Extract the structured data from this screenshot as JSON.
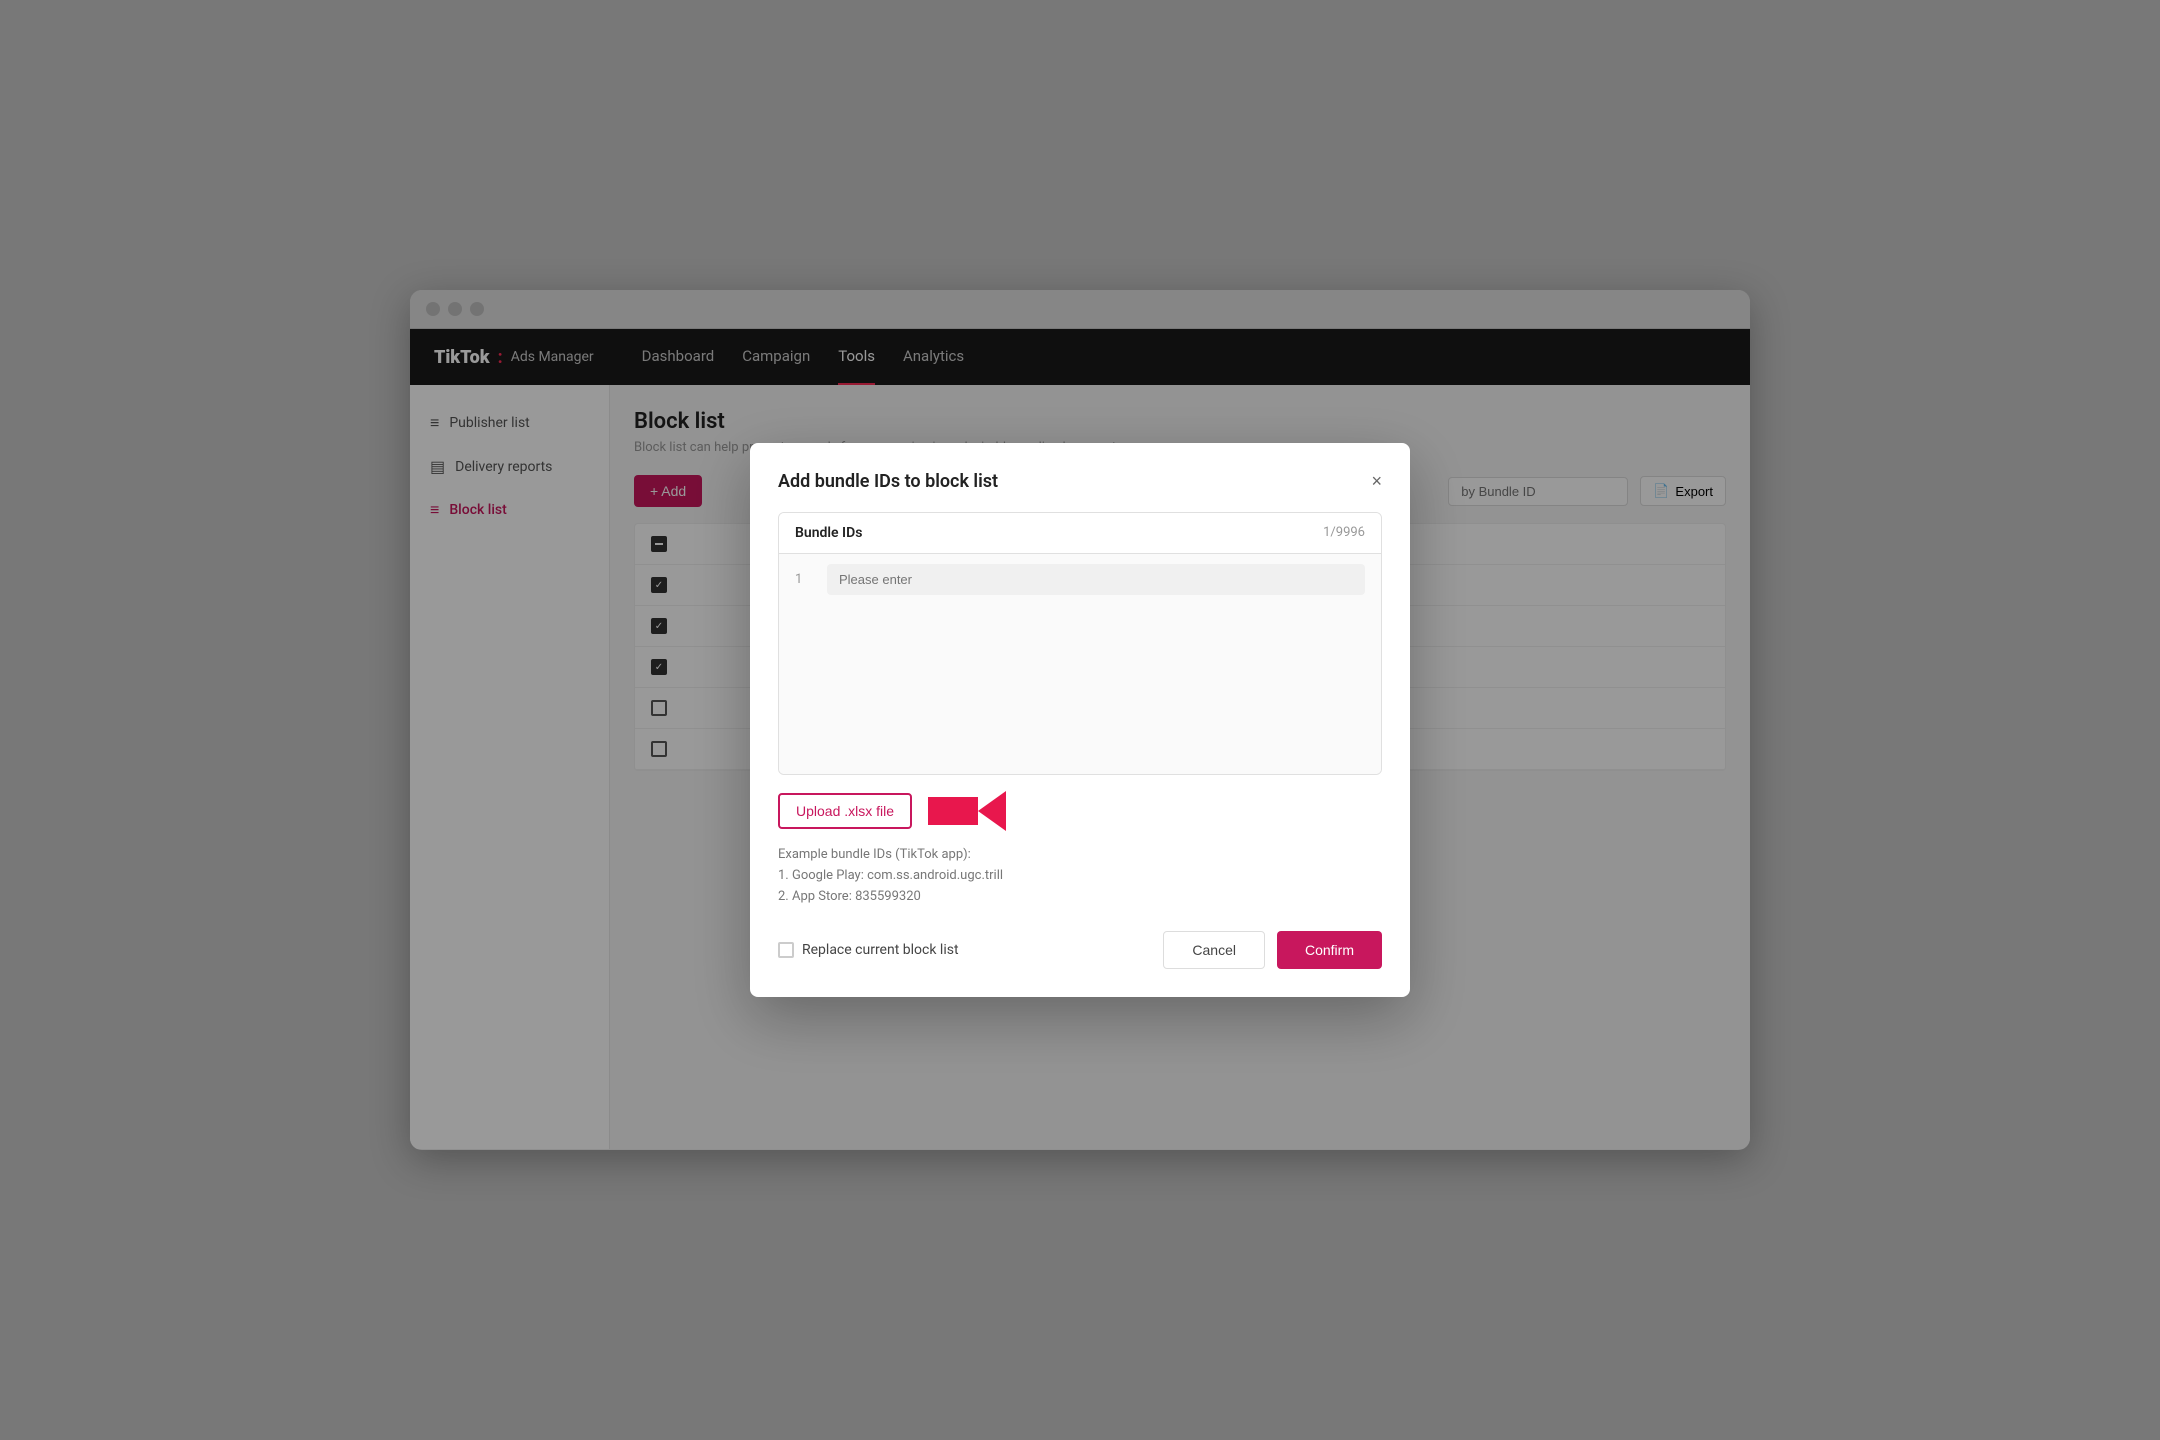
{
  "browser": {
    "dots": [
      "dot1",
      "dot2",
      "dot3"
    ]
  },
  "nav": {
    "brand": "TikTok",
    "brand_colon": ":",
    "brand_sub": "Ads Manager",
    "items": [
      {
        "label": "Dashboard",
        "active": false
      },
      {
        "label": "Campaign",
        "active": false
      },
      {
        "label": "Tools",
        "active": true
      },
      {
        "label": "Analytics",
        "active": false
      }
    ]
  },
  "sidebar": {
    "items": [
      {
        "label": "Publisher list",
        "active": false,
        "icon": "≡"
      },
      {
        "label": "Delivery reports",
        "active": false,
        "icon": "▤"
      },
      {
        "label": "Block list",
        "active": true,
        "icon": "≡"
      }
    ]
  },
  "content": {
    "page_title": "Block list",
    "page_desc": "Block list can help prevent your ads from appearing in undesirable media placements.",
    "add_button": "+ Add",
    "search_placeholder": "by Bundle ID",
    "export_label": "Export"
  },
  "modal": {
    "title": "Add bundle IDs to block list",
    "close_label": "×",
    "bundle_ids_label": "Bundle IDs",
    "bundle_ids_count": "1/9996",
    "row_number": "1",
    "row_placeholder": "Please enter",
    "upload_button": "Upload .xlsx file",
    "examples_title": "Example bundle IDs (TikTok app):",
    "example1": "1. Google Play: com.ss.android.ugc.trill",
    "example2": "2. App Store: 835599320",
    "replace_label": "Replace current block list",
    "cancel_label": "Cancel",
    "confirm_label": "Confirm"
  },
  "table": {
    "rows": [
      {
        "checked": "indeterminate"
      },
      {
        "checked": "checked"
      },
      {
        "checked": "checked"
      },
      {
        "checked": "checked"
      },
      {
        "checked": "unchecked"
      },
      {
        "checked": "unchecked"
      }
    ]
  },
  "colors": {
    "brand_red": "#c8175d",
    "nav_bg": "#1a1a1a"
  }
}
